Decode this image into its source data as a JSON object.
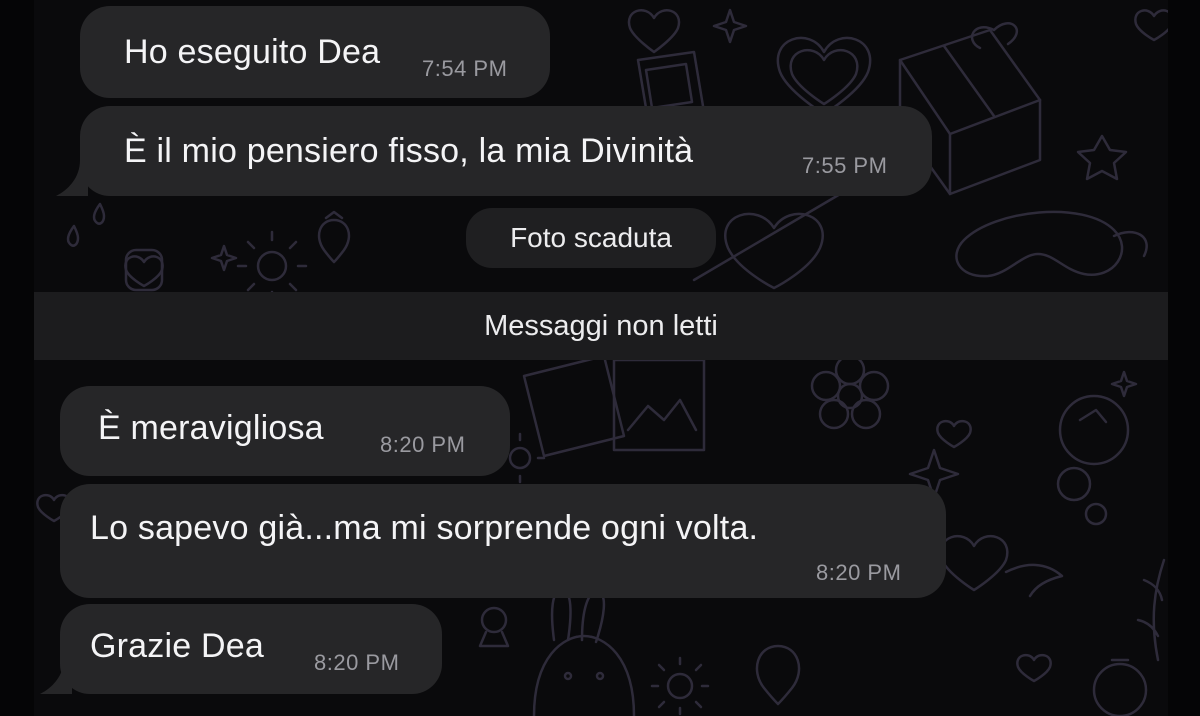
{
  "messages": [
    {
      "text": "Ho eseguito Dea",
      "time": "7:54 PM"
    },
    {
      "text": "È il mio pensiero fisso, la mia Divinità",
      "time": "7:55 PM"
    },
    {
      "text": "È meravigliosa",
      "time": "8:20 PM"
    },
    {
      "text": "Lo sapevo già...ma mi sorprende ogni volta.",
      "time": "8:20 PM"
    },
    {
      "text": "Grazie Dea",
      "time": "8:20 PM"
    }
  ],
  "system": {
    "expired_photo": "Foto scaduta",
    "unread_divider": "Messaggi non letti"
  },
  "colors": {
    "bubble": "#262628",
    "background": "#0a0a0c",
    "time_text": "#9a9aa0",
    "divider": "#1c1c1e"
  },
  "icons": [
    "heart-icon",
    "gift-box-icon",
    "star-icon",
    "flower-icon",
    "sun-icon",
    "strawberry-icon",
    "bunny-icon",
    "wing-heart-icon",
    "photo-frame-icon",
    "sparkle-icon"
  ]
}
